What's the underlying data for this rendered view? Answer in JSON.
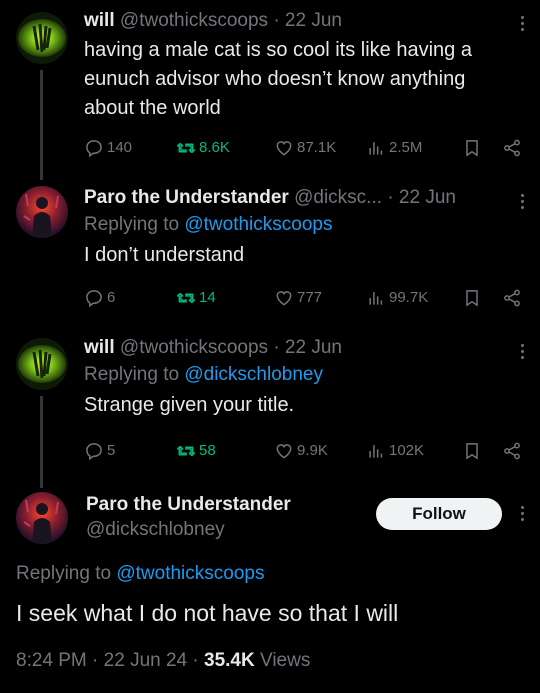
{
  "tweets": [
    {
      "author": "will",
      "handle": "@twothickscoops",
      "date": "22 Jun",
      "text": "having a male cat is so cool its like having a eunuch advisor who doesn’t know anything about the world",
      "replies": "140",
      "retweets": "8.6K",
      "likes": "87.1K",
      "views": "2.5M"
    },
    {
      "author": "Paro the Understander",
      "handle": "@dicksc...",
      "date": "22 Jun",
      "reply_prefix": "Replying to",
      "reply_handle": "@twothickscoops",
      "text": "I don’t understand",
      "replies": "6",
      "retweets": "14",
      "likes": "777",
      "views": "99.7K"
    },
    {
      "author": "will",
      "handle": "@twothickscoops",
      "date": "22 Jun",
      "reply_prefix": "Replying to",
      "reply_handle": "@dickschlobney",
      "text": "Strange given your title.",
      "replies": "5",
      "retweets": "58",
      "likes": "9.9K",
      "views": "102K"
    }
  ],
  "main": {
    "author": "Paro the Understander",
    "handle": "@dickschlobney",
    "follow_label": "Follow",
    "reply_prefix": "Replying to",
    "reply_handle": "@twothickscoops",
    "text": "I seek what I do not have so that I will",
    "time": "8:24 PM",
    "date": "22 Jun 24",
    "views_count": "35.4K",
    "views_label": "Views"
  },
  "icons": [
    "reply-icon",
    "retweet-icon",
    "like-icon",
    "views-icon",
    "bookmark-icon",
    "share-icon",
    "more-icon"
  ],
  "colors": {
    "background": "#000000",
    "text": "#e7e9ea",
    "muted": "#71767b",
    "link": "#1d9bf0",
    "retweeted": "#00ba7c"
  }
}
